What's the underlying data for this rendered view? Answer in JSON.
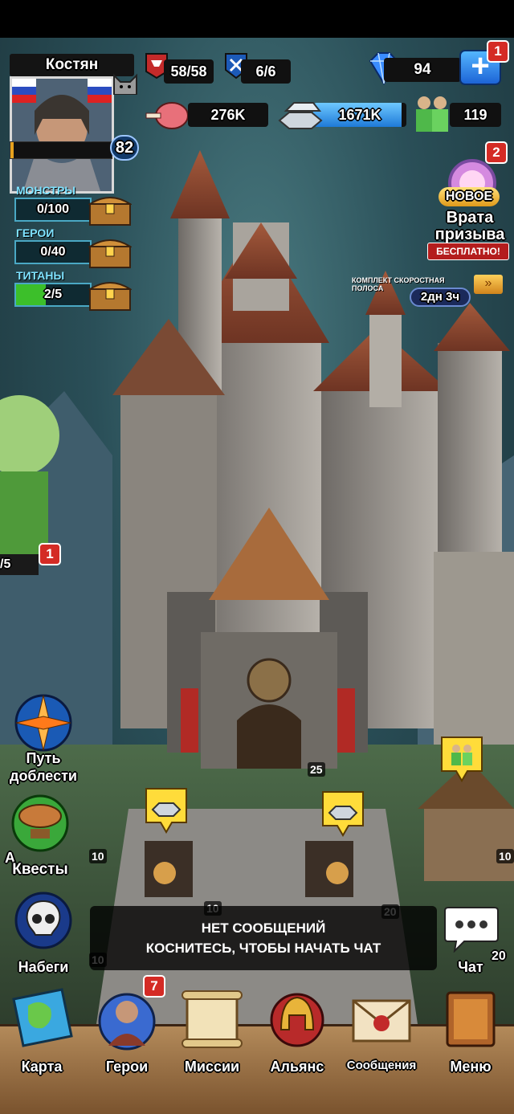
{
  "player": {
    "name": "Костян",
    "level": "82",
    "xp_fraction": 0.03
  },
  "resources": {
    "troops": "58/58",
    "tokens": "6/6",
    "gems": "94",
    "gems_badge": "1",
    "food": "276K",
    "iron": "1671K",
    "iron_fill": 0.95,
    "workers": "119"
  },
  "chests": [
    {
      "label": "МОНСТРЫ",
      "value": "0/100",
      "fill": 0
    },
    {
      "label": "ГЕРОИ",
      "value": "0/40",
      "fill": 0
    },
    {
      "label": "ТИТАНЫ",
      "value": "2/5",
      "fill": 0.4
    }
  ],
  "summon": {
    "badge": "2",
    "new_tag": "НОВОЕ",
    "title_line1": "Врата",
    "title_line2": "призыва",
    "free_tag": "БЕСПЛАТНО!",
    "offer_label": "КОМПЛЕКТ СКОРОСТНАЯ ПОЛОСА",
    "offer_timer": "2дн 3ч"
  },
  "side": {
    "airship_count": "/5",
    "airship_badge": "1",
    "valor_line1": "Путь",
    "valor_line2": "доблести",
    "alliance_partial": "А",
    "quests_label": "Квесты",
    "raids_label": "Набеги"
  },
  "building_levels": {
    "castle": "25",
    "left": "10",
    "center": "10",
    "right": "20",
    "far_right": "10",
    "bottom_left": "10"
  },
  "chat": {
    "line1": "НЕТ СООБЩЕНИЙ",
    "line2": "КОСНИТЕСЬ, ЧТОБЫ НАЧАТЬ ЧАТ",
    "button_label": "Чат",
    "side_number": "20"
  },
  "nav": [
    {
      "label": "Карта",
      "icon": "map-icon"
    },
    {
      "label": "Герои",
      "icon": "heroes-icon",
      "badge": "7"
    },
    {
      "label": "Миссии",
      "icon": "scroll-icon"
    },
    {
      "label": "Альянс",
      "icon": "helmet-icon"
    },
    {
      "label": "Сообщения",
      "icon": "envelope-icon"
    },
    {
      "label": "Меню",
      "icon": "book-icon"
    }
  ]
}
